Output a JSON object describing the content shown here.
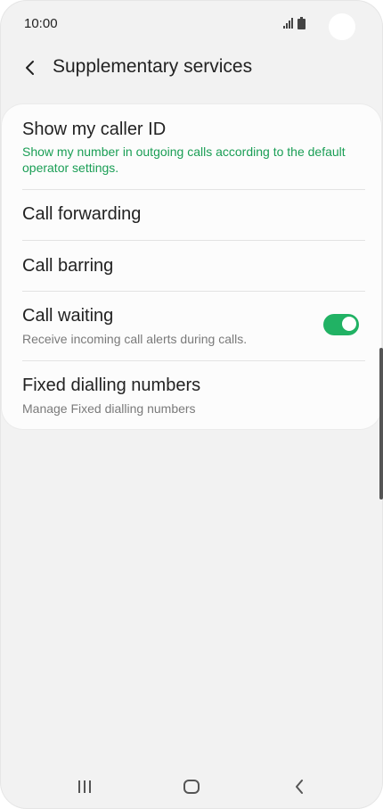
{
  "status": {
    "time": "10:00"
  },
  "header": {
    "title": "Supplementary services"
  },
  "settings": [
    {
      "title": "Show my caller ID",
      "subtitle": "Show my number in outgoing calls according to the default operator settings."
    },
    {
      "title": "Call forwarding"
    },
    {
      "title": "Call barring"
    },
    {
      "title": "Call waiting",
      "subtitle": "Receive incoming call alerts during calls.",
      "toggle": "on"
    },
    {
      "title": "Fixed dialling numbers",
      "subtitle": "Manage Fixed dialling numbers"
    }
  ],
  "colors": {
    "accent": "#21b264",
    "accent_text": "#1a9e55",
    "background": "#f2f2f2",
    "card": "#fcfcfc"
  },
  "icons": {
    "back": "chevron-left-icon",
    "recents": "recents-icon",
    "home": "home-icon",
    "nav_back": "back-icon"
  }
}
